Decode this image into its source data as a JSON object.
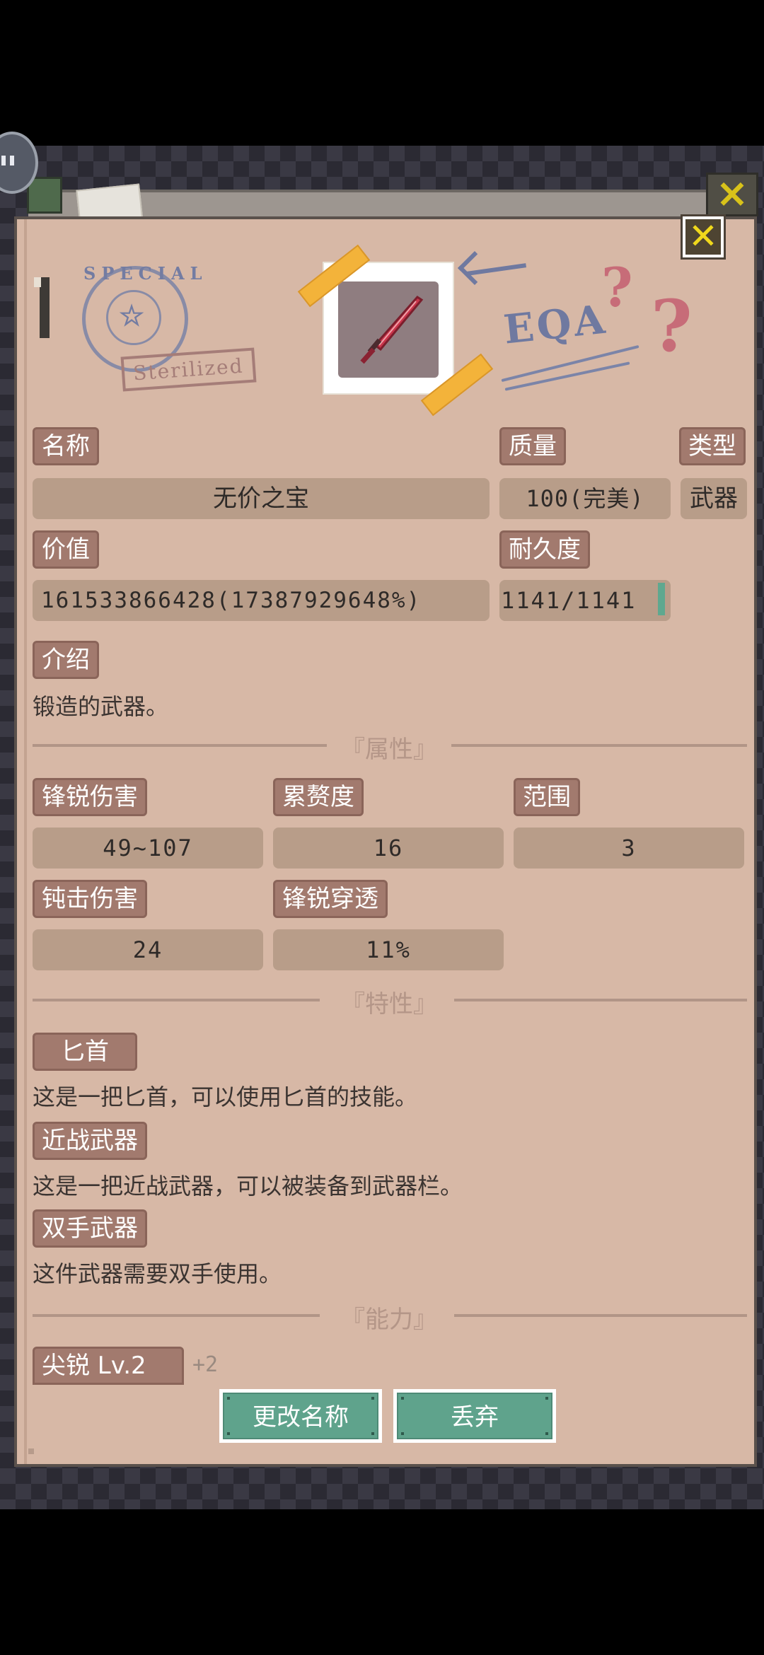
{
  "colors": {
    "panel": "#d7b8a6",
    "label_bg": "#a27a6e",
    "value_bg": "#b89d89",
    "button": "#5fa38c",
    "close_icon": "#f0d81c",
    "durability_bar": "#5fa88f"
  },
  "item": {
    "icon": "red-dagger-icon",
    "name_label": "名称",
    "name": "无价之宝",
    "quality_label": "质量",
    "quality": "100(完美)",
    "type_label": "类型",
    "type": "武器",
    "value_label": "价值",
    "value": "161533866428(17387929648%)",
    "durability_label": "耐久度",
    "durability": "1141/1141",
    "durability_fraction": 1.0,
    "intro_label": "介绍",
    "intro": "锻造的武器。"
  },
  "decor": {
    "stamp_text": "SPECIAL",
    "sterilized": "Sterilized",
    "eqa": "EQA",
    "qmark": "?"
  },
  "sections": {
    "attributes": "『属性』",
    "traits": "『特性』",
    "abilities": "『能力』"
  },
  "attributes": {
    "sharp_damage_label": "锋锐伤害",
    "sharp_damage": "49~107",
    "burden_label": "累赘度",
    "burden": "16",
    "range_label": "范围",
    "range": "3",
    "blunt_damage_label": "钝击伤害",
    "blunt_damage": "24",
    "sharp_pierce_label": "锋锐穿透",
    "sharp_pierce": "11%"
  },
  "traits": [
    {
      "name": "匕首",
      "desc": "这是一把匕首，可以使用匕首的技能。"
    },
    {
      "name": "近战武器",
      "desc": "这是一把近战武器，可以被装备到武器栏。"
    },
    {
      "name": "双手武器",
      "desc": "这件武器需要双手使用。"
    }
  ],
  "abilities": [
    {
      "name": "尖锐 Lv.2",
      "bonus": "+2"
    }
  ],
  "buttons": {
    "rename": "更改名称",
    "discard": "丢弃"
  }
}
